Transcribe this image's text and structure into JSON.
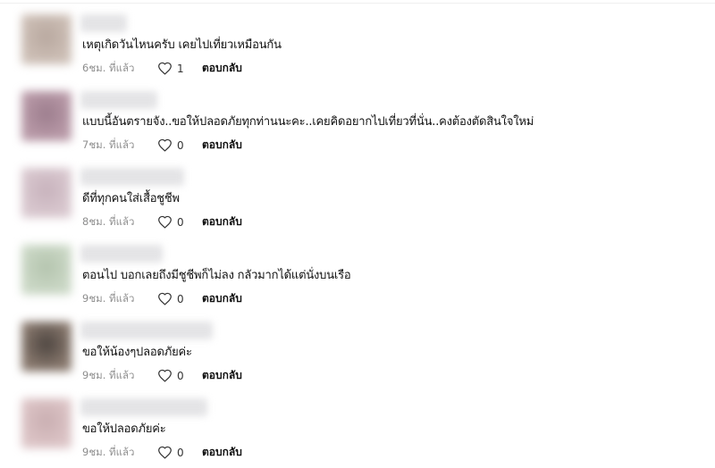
{
  "comments": [
    {
      "text": "เหตุเกิดวันไหนครับ เคยไปเที่ยวเหมือนกัน",
      "time": "6ชม. ที่แล้ว",
      "likes": "1",
      "reply_label": "ตอบกลับ",
      "avatar_colors": [
        "#cdbfb6",
        "#b8a89f"
      ]
    },
    {
      "text": "แบบนี้อันตรายจัง..ขอให้ปลอดภัยทุกท่านนะคะ..เคยคิดอยากไปเที่ยวที่นั่น..คงต้องตัดสินใจใหม่",
      "time": "7ชม. ที่แล้ว",
      "likes": "0",
      "reply_label": "ตอบกลับ",
      "avatar_colors": [
        "#b99aa8",
        "#9c7d8d"
      ]
    },
    {
      "text": "ดีที่ทุกคนใส่เสื้อชูชีพ",
      "time": "8ชม. ที่แล้ว",
      "likes": "0",
      "reply_label": "ตอบกลับ",
      "avatar_colors": [
        "#d9c8cf",
        "#c7b2bc"
      ]
    },
    {
      "text": "ตอนไป บอกเลยถึงมีชูชีพก็ไม่ลง กลัวมากได้แต่นั่งบนเรือ",
      "time": "9ชม. ที่แล้ว",
      "likes": "0",
      "reply_label": "ตอบกลับ",
      "avatar_colors": [
        "#cbd8c6",
        "#b4c4ae"
      ]
    },
    {
      "text": "ขอให้น้องๆปลอดภัยค่ะ",
      "time": "9ชม. ที่แล้ว",
      "likes": "0",
      "reply_label": "ตอบกลับ",
      "avatar_colors": [
        "#8a7a6f",
        "#4d4540"
      ]
    },
    {
      "text": "ขอให้ปลอดภัยค่ะ",
      "time": "9ชม. ที่แล้ว",
      "likes": "0",
      "reply_label": "ตอบกลับ",
      "avatar_colors": [
        "#dcc4c6",
        "#c9aeb1"
      ]
    }
  ]
}
